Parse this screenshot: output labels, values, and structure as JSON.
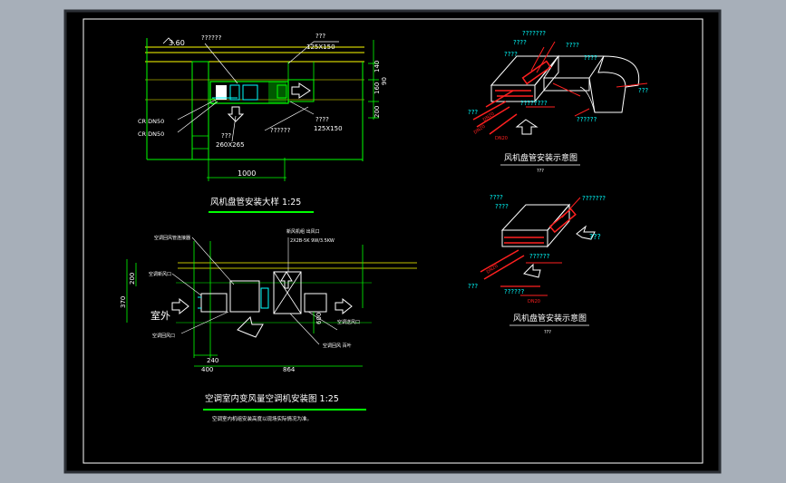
{
  "colors": {
    "desktop": "#a7afb9",
    "sheet_border": "#2c3036",
    "canvas": "#000000",
    "outline": "#ffffff",
    "green": "#00ff00",
    "cyan": "#00ffff",
    "red": "#ff2020",
    "magenta": "#ff00ff",
    "yellow": "#ffff00",
    "white": "#ffffff"
  },
  "detail_top": {
    "level": "3.60",
    "unknown_a": "??????",
    "unknown_b": "???",
    "duct_size_a": "125X150",
    "dim_140": "140",
    "dim_90": "90",
    "dim_160": "160",
    "dim_200": "200",
    "pipe_a": "CR DN50",
    "pipe_b": "CR DN50",
    "unknown_c": "???",
    "grille": "260X265",
    "unknown_d": "??????",
    "unknown_e": "????",
    "duct_size_b": "125X150",
    "width": "1000",
    "title": "风机盘管安装大样 1:25"
  },
  "detail_bottom": {
    "note_a": "空调回风管连接器",
    "note_b": "新风机组 出风口",
    "spec": "2X2B-5K  9W/3.5KW",
    "note_c": "空调新风口",
    "note_d": "空调回风口",
    "note_e": "空调送风口",
    "note_f": "空调回风 百叶",
    "dim_200": "200",
    "dim_370": "370",
    "outdoor": "室外",
    "dim_240": "240",
    "dim_400": "400",
    "dim_864": "864",
    "dim_600": "600",
    "title": "空调室内变风量空调机安装图 1:25",
    "note": "空调室内机组安装高度以现场实际情况为准。"
  },
  "iso_top": {
    "l1": "???????",
    "l2": "????",
    "l3": "????",
    "l4": "????",
    "l5": "????",
    "l6": "???",
    "l7": "????????",
    "l8": "??????",
    "l9": "???",
    "l10": "DN20",
    "l11": "DN20",
    "l12": "DN20",
    "title": "风机盘管安装示意图",
    "subtitle": "???"
  },
  "iso_bottom": {
    "l1": "????",
    "l2": "????",
    "l3": "???????",
    "l4": "???",
    "l5": "??????",
    "l6": "???",
    "l7": "??????",
    "l8": "DN20",
    "l9": "DN20",
    "title": "风机盘管安装示意图",
    "subtitle": "???"
  }
}
